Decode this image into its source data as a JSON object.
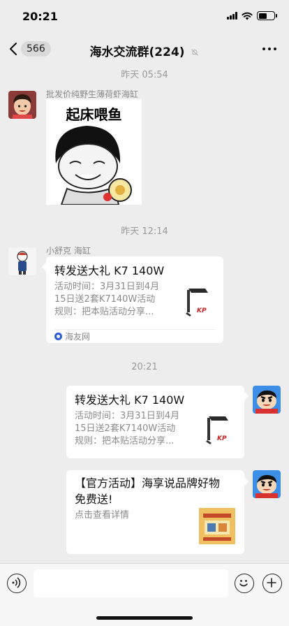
{
  "status_bar": {
    "time": "20:21"
  },
  "nav": {
    "unread_count": "566",
    "title": "海水交流群(224)"
  },
  "messages": {
    "timestamp_1": "昨天 05:54",
    "sticker_sender": "批发价纯野生薄荷虾海缸",
    "sticker_caption": "起床喂鱼",
    "timestamp_2": "昨天 12:14",
    "card1_sender": "小舒克 海缸",
    "card1": {
      "title": "转发送大礼 K7 140W",
      "desc_line1": "活动时间：3月31日到4月",
      "desc_line2": "15日送2套K7140W活动",
      "desc_line3": "规则：把本贴活动分享...",
      "source": "海友网"
    },
    "timestamp_3": "20:21",
    "card2": {
      "title": "转发送大礼 K7 140W",
      "desc_line1": "活动时间：3月31日到4月",
      "desc_line2": "15日送2套K7140W活动",
      "desc_line3": "规则：把本贴活动分享..."
    },
    "card3": {
      "title_line1": "【官方活动】海享说品牌好物",
      "title_line2": "免费送!",
      "desc": "点击查看详情"
    }
  },
  "colors": {
    "background": "#ededed",
    "bubble": "#ffffff",
    "meta_text": "#9a9a9a"
  }
}
